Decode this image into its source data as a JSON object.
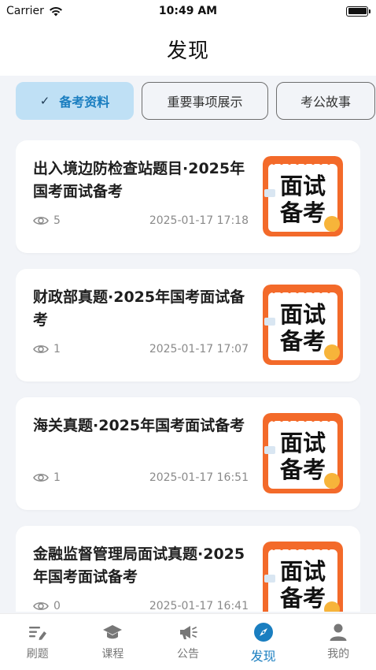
{
  "status_bar": {
    "carrier": "Carrier",
    "time": "10:49 AM"
  },
  "header": {
    "title": "发现"
  },
  "tabs": [
    {
      "label": "备考资料",
      "active": true
    },
    {
      "label": "重要事项展示",
      "active": false
    },
    {
      "label": "考公故事",
      "active": false
    }
  ],
  "articles": [
    {
      "title": "出入境边防检查站题目·2025年国考面试备考",
      "views": "5",
      "date": "2025-01-17 17:18",
      "thumb_text": [
        "面试",
        "备考"
      ]
    },
    {
      "title": "财政部真题·2025年国考面试备考",
      "views": "1",
      "date": "2025-01-17 17:07",
      "thumb_text": [
        "面试",
        "备考"
      ]
    },
    {
      "title": "海关真题·2025年国考面试备考",
      "views": "1",
      "date": "2025-01-17 16:51",
      "thumb_text": [
        "面试",
        "备考"
      ]
    },
    {
      "title": "金融监督管理局面试真题·2025年国考面试备考",
      "views": "0",
      "date": "2025-01-17 16:41",
      "thumb_text": [
        "面试",
        "备考"
      ]
    }
  ],
  "tabbar": [
    {
      "label": "刷题",
      "icon": "pencil-list-icon",
      "active": false
    },
    {
      "label": "课程",
      "icon": "graduation-cap-icon",
      "active": false
    },
    {
      "label": "公告",
      "icon": "megaphone-icon",
      "active": false
    },
    {
      "label": "发现",
      "icon": "compass-icon",
      "active": true
    },
    {
      "label": "我的",
      "icon": "person-icon",
      "active": false
    }
  ],
  "colors": {
    "accent": "#1a7ec0",
    "active_tab_bg": "#bfe0f5",
    "thumb_orange": "#f36a2a"
  }
}
